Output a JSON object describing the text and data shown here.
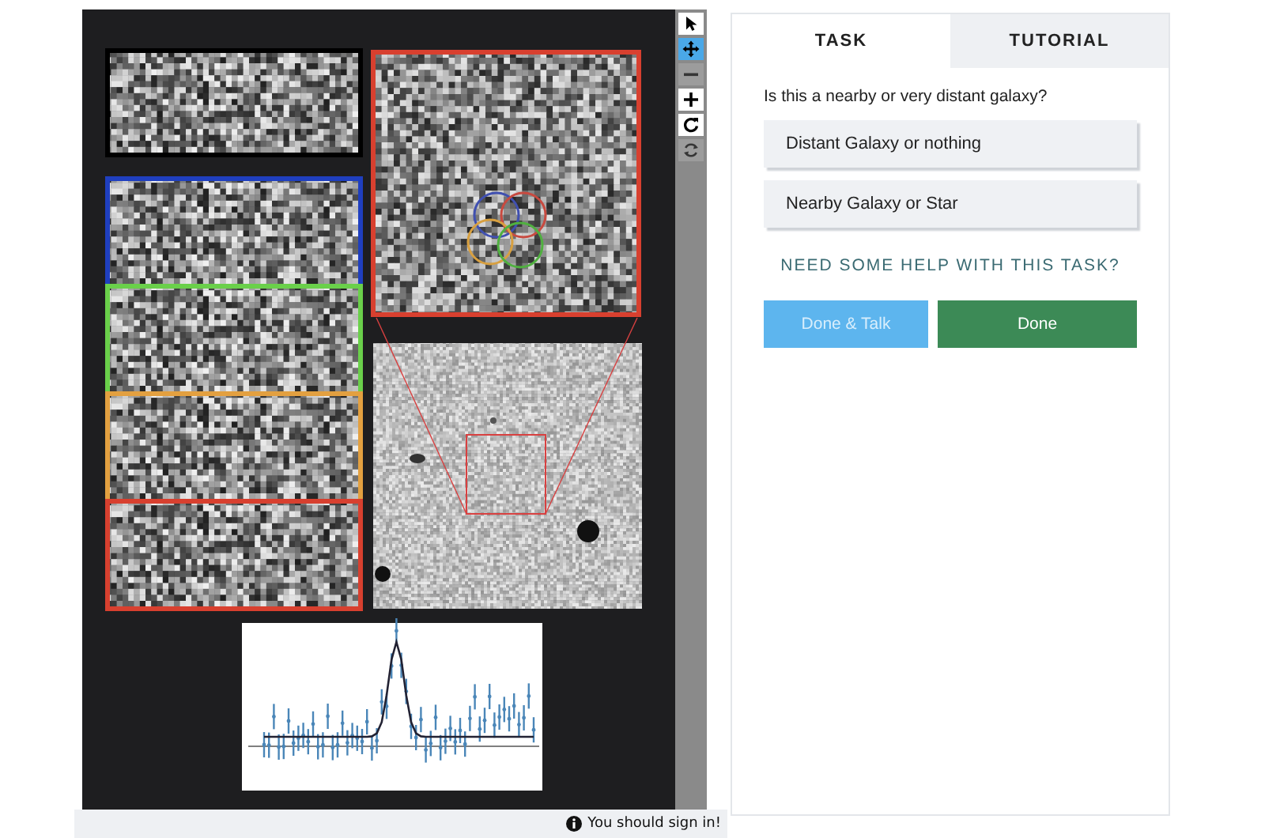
{
  "viewer": {
    "cutouts": [
      {
        "color": "#000000"
      },
      {
        "color": "#1f3fbf"
      },
      {
        "color": "#6ad04a"
      },
      {
        "color": "#e3a040"
      },
      {
        "color": "#d8402f"
      }
    ],
    "zoom_markers": [
      {
        "color": "#4050b0"
      },
      {
        "color": "#c84a40"
      },
      {
        "color": "#d8a040"
      },
      {
        "color": "#50b040"
      }
    ]
  },
  "toolbar": [
    {
      "kind": "pointer",
      "selected": false,
      "disabled": false
    },
    {
      "kind": "move",
      "selected": true,
      "disabled": false
    },
    {
      "kind": "zoom-out",
      "selected": false,
      "disabled": true
    },
    {
      "kind": "zoom-in",
      "selected": false,
      "disabled": false
    },
    {
      "kind": "rotate",
      "selected": false,
      "disabled": false
    },
    {
      "kind": "reset",
      "selected": false,
      "disabled": true
    }
  ],
  "notice": {
    "text": "You should sign in!"
  },
  "tabs": [
    {
      "label": "TASK",
      "selected": true
    },
    {
      "label": "TUTORIAL",
      "selected": false
    }
  ],
  "question": "Is this a nearby or very distant galaxy?",
  "answers": [
    {
      "label": "Distant Galaxy or nothing",
      "selected": false
    },
    {
      "label": "Nearby Galaxy or Star",
      "selected": false
    }
  ],
  "help_link": "NEED SOME HELP WITH THIS TASK?",
  "buttons": [
    {
      "label": "Done & Talk",
      "kind": "secondary"
    },
    {
      "label": "Done",
      "kind": "primary"
    }
  ]
}
